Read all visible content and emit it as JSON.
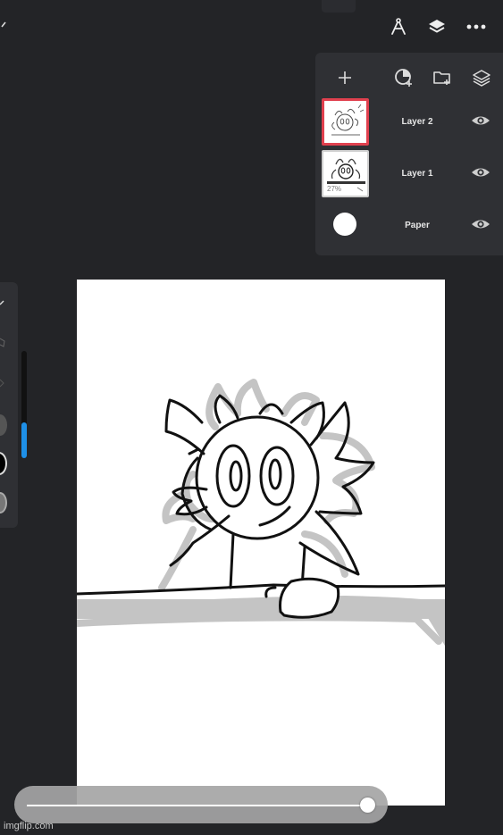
{
  "toolbar": {
    "icons": [
      "compass-icon",
      "layers-icon",
      "more-icon"
    ]
  },
  "layers_panel": {
    "header_icons": [
      "add-layer-icon",
      "add-fill-layer-icon",
      "add-folder-icon",
      "layer-options-icon"
    ],
    "layers": [
      {
        "name": "Layer 2",
        "selected": true,
        "visible": true
      },
      {
        "name": "Layer 1",
        "selected": false,
        "visible": true,
        "thumb_label": "27%"
      },
      {
        "name": "Paper",
        "selected": false,
        "visible": true
      }
    ]
  },
  "brush_panel": {
    "size_level": 0.33,
    "accent_color": "#1e90e8"
  },
  "bottom_slider": {
    "value": 0.97
  },
  "watermark": "imgflip.com"
}
